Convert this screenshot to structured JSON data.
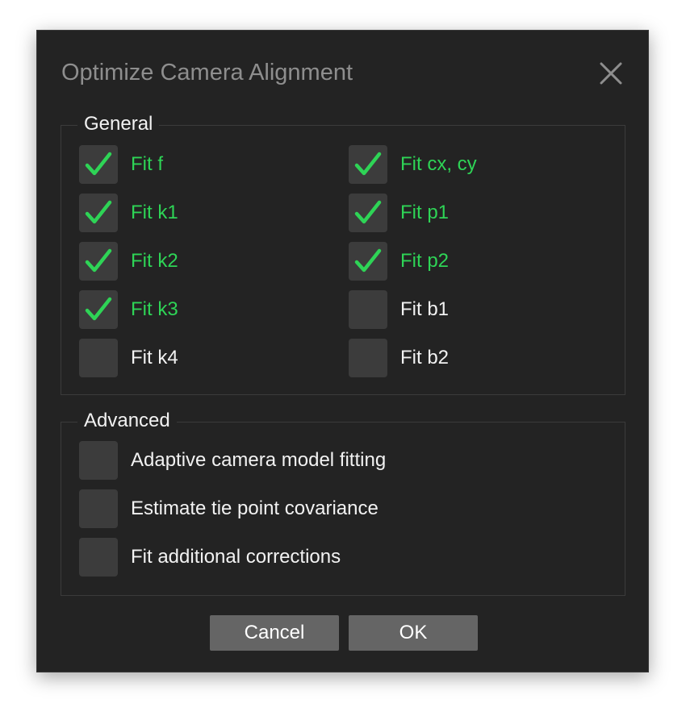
{
  "dialog": {
    "title": "Optimize Camera Alignment"
  },
  "general": {
    "legend": "General",
    "options": [
      {
        "label": "Fit f",
        "checked": true
      },
      {
        "label": "Fit cx, cy",
        "checked": true
      },
      {
        "label": "Fit k1",
        "checked": true
      },
      {
        "label": "Fit p1",
        "checked": true
      },
      {
        "label": "Fit k2",
        "checked": true
      },
      {
        "label": "Fit p2",
        "checked": true
      },
      {
        "label": "Fit k3",
        "checked": true
      },
      {
        "label": "Fit b1",
        "checked": false
      },
      {
        "label": "Fit k4",
        "checked": false
      },
      {
        "label": "Fit b2",
        "checked": false
      }
    ]
  },
  "advanced": {
    "legend": "Advanced",
    "options": [
      {
        "label": "Adaptive camera model fitting",
        "checked": false
      },
      {
        "label": "Estimate tie point covariance",
        "checked": false
      },
      {
        "label": "Fit additional corrections",
        "checked": false
      }
    ]
  },
  "buttons": {
    "cancel": "Cancel",
    "ok": "OK"
  },
  "colors": {
    "checked_text": "#2ed456",
    "background": "#232323",
    "checkbox": "#3c3c3c",
    "button": "#656565"
  },
  "icons": {
    "close": "close-icon",
    "check": "check-icon"
  }
}
